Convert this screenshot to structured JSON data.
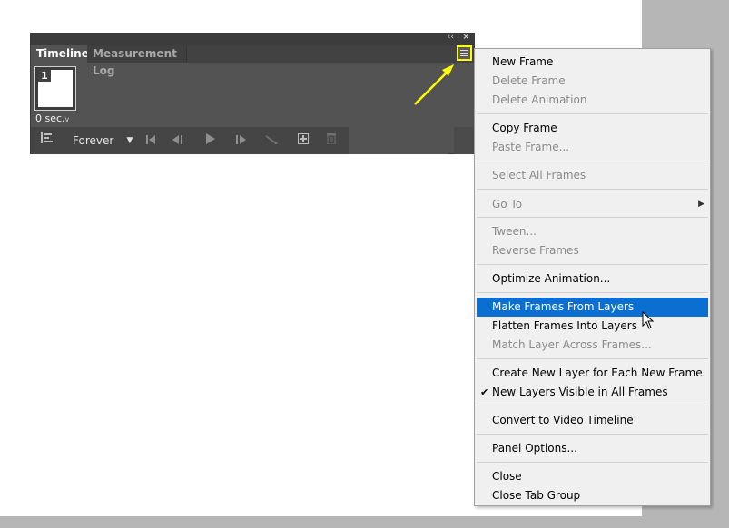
{
  "panel": {
    "tabs": [
      {
        "label": "Timeline",
        "active": true
      },
      {
        "label": "Measurement Log",
        "active": false
      }
    ],
    "collapse_glyph": "‹‹",
    "close_glyph": "×",
    "frame": {
      "number": "1",
      "delay": "0 sec.",
      "delay_caret": "v"
    },
    "controls": {
      "loop_value": "Forever",
      "icons": [
        "convert-to-video-icon",
        "first-frame-icon",
        "previous-frame-icon",
        "play-icon",
        "next-frame-icon",
        "tween-icon",
        "duplicate-frame-icon",
        "delete-frame-icon"
      ]
    },
    "menu_button_icon": "hamburger-menu-icon",
    "highlight_color": "#ffff00"
  },
  "menu": {
    "items": [
      {
        "label": "New Frame",
        "disabled": false
      },
      {
        "label": "Delete Frame",
        "disabled": true
      },
      {
        "label": "Delete Animation",
        "disabled": true
      },
      {
        "label": "Copy Frame",
        "disabled": false
      },
      {
        "label": "Paste Frame...",
        "disabled": true
      },
      {
        "label": "Select All Frames",
        "disabled": true
      },
      {
        "label": "Go To",
        "disabled": true,
        "submenu": true
      },
      {
        "label": "Tween...",
        "disabled": true
      },
      {
        "label": "Reverse Frames",
        "disabled": true
      },
      {
        "label": "Optimize Animation...",
        "disabled": false
      },
      {
        "label": "Make Frames From Layers",
        "disabled": false,
        "highlighted": true
      },
      {
        "label": "Flatten Frames Into Layers",
        "disabled": false
      },
      {
        "label": "Match Layer Across Frames...",
        "disabled": true
      },
      {
        "label": "Create New Layer for Each New Frame",
        "disabled": false
      },
      {
        "label": "New Layers Visible in All Frames",
        "disabled": false,
        "checked": true
      },
      {
        "label": "Convert to Video Timeline",
        "disabled": false
      },
      {
        "label": "Panel Options...",
        "disabled": false
      },
      {
        "label": "Close",
        "disabled": false
      },
      {
        "label": "Close Tab Group",
        "disabled": false
      }
    ],
    "check_glyph": "✔",
    "submenu_glyph": "▶",
    "highlight_color": "#0a6fd0"
  }
}
